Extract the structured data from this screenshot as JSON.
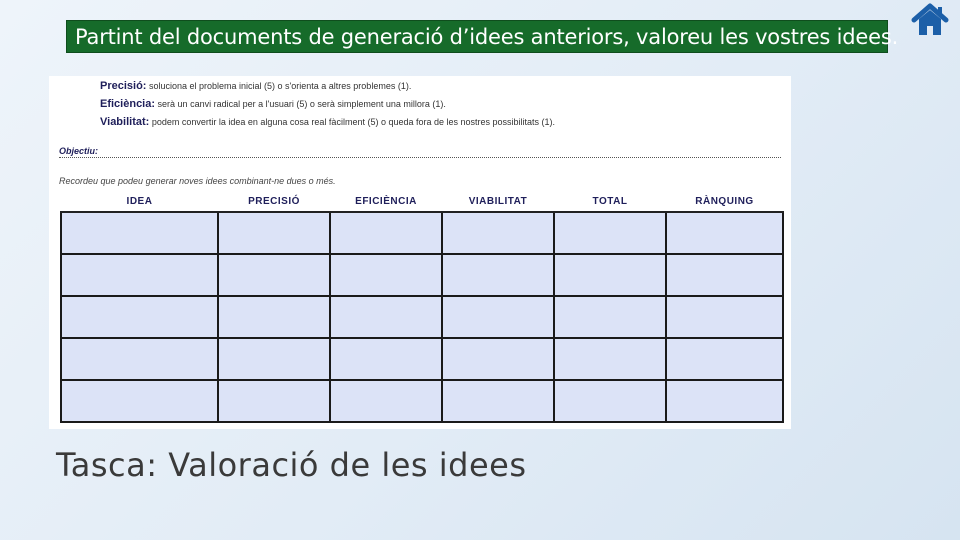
{
  "slide": {
    "banner_text": "Partint del documents de generació d’idees anteriors, valoreu les vostres idees.",
    "caption": "Tasca: Valoració de les idees",
    "home_icon": "home-icon",
    "colors": {
      "banner_bg": "#166b2a",
      "cell_bg": "#dce3f7",
      "header_text": "#1f1f5a"
    }
  },
  "document": {
    "criteria": [
      {
        "label": "Precisió:",
        "text": "soluciona el problema inicial (5) o s'orienta a altres problemes (1)."
      },
      {
        "label": "Eficiència:",
        "text": "serà un canvi radical per a l'usuari (5) o serà simplement una millora (1)."
      },
      {
        "label": "Viabilitat:",
        "text": "podem convertir la idea en alguna cosa real fàcilment (5) o queda fora de les nostres possibilitats (1)."
      }
    ],
    "objective_label": "Objectiu:",
    "reminder": "Recordeu que podeu generar noves idees combinant-ne dues o més.",
    "table": {
      "headers": [
        "IDEA",
        "PRECISIÓ",
        "EFICIÈNCIA",
        "VIABILITAT",
        "TOTAL",
        "RÀNQUING"
      ],
      "rows": 5
    }
  }
}
